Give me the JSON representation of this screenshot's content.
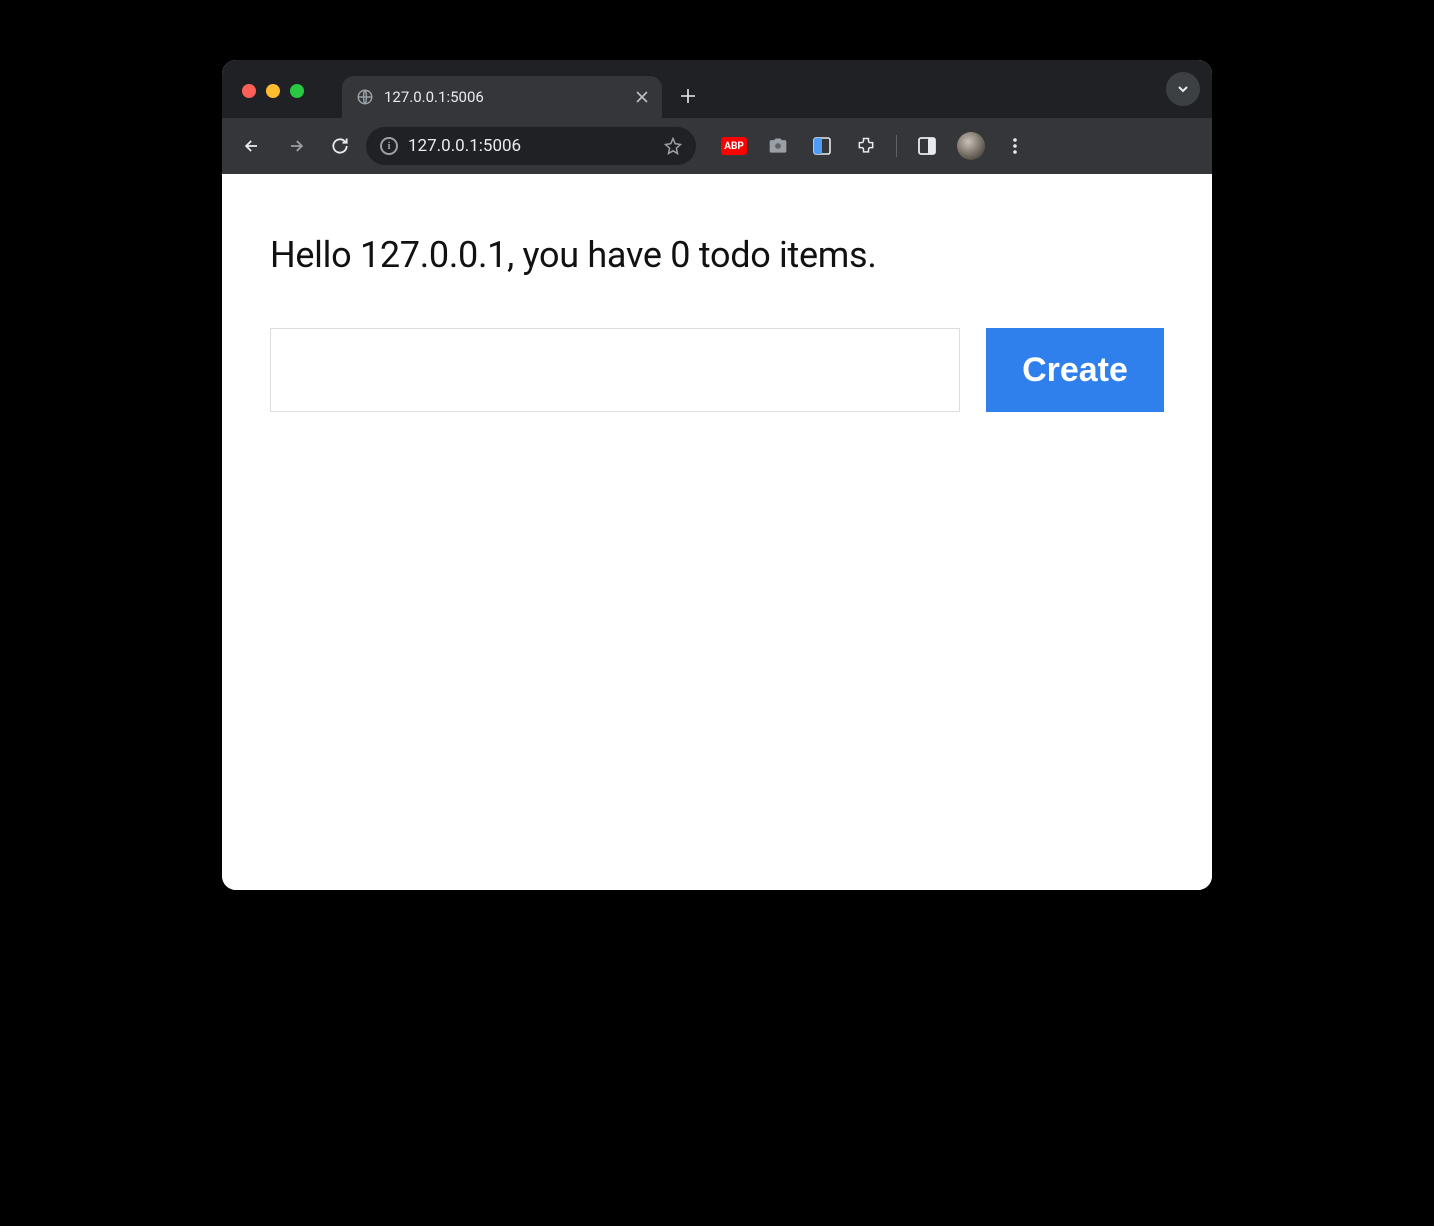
{
  "browser": {
    "tab": {
      "title": "127.0.0.1:5006"
    },
    "omnibox": {
      "url": "127.0.0.1:5006"
    },
    "extensions": {
      "abp_label": "ABP"
    }
  },
  "page": {
    "heading": "Hello 127.0.0.1, you have 0 todo items.",
    "form": {
      "input_value": "",
      "create_label": "Create"
    }
  }
}
